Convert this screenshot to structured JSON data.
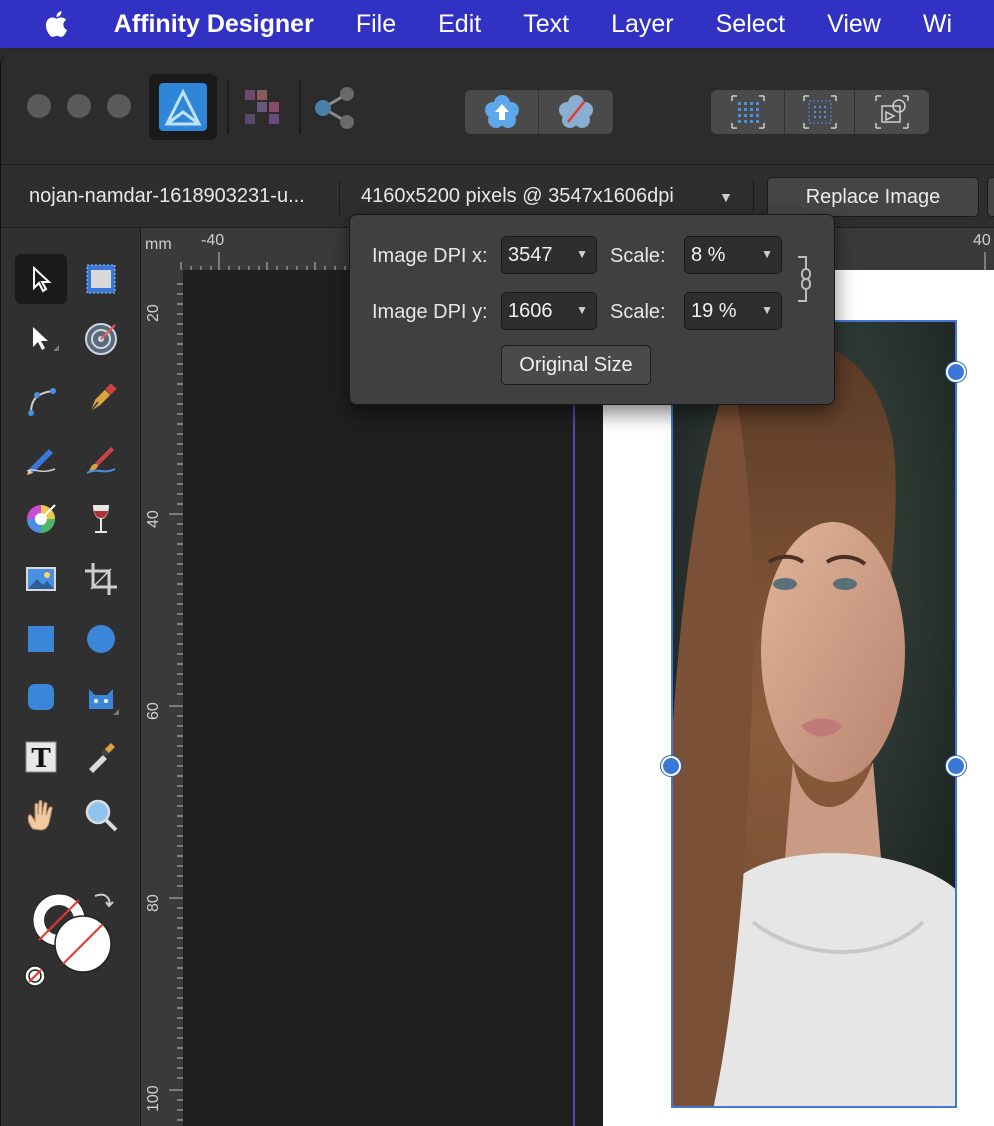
{
  "menubar": {
    "app_name": "Affinity Designer",
    "items": [
      "File",
      "Edit",
      "Text",
      "Layer",
      "Select",
      "View",
      "Wi"
    ]
  },
  "context": {
    "filename": "nojan-namdar-1618903231-u...",
    "dpi_info": "4160x5200 pixels @ 3547x1606dpi",
    "replace_label": "Replace Image"
  },
  "popover": {
    "dpi_x_label": "Image DPI x:",
    "dpi_x_value": "3547",
    "dpi_y_label": "Image DPI y:",
    "dpi_y_value": "1606",
    "scale_label": "Scale:",
    "scale_x_value": "8 %",
    "scale_y_value": "19 %",
    "original_size_label": "Original Size"
  },
  "ruler": {
    "unit": "mm",
    "top_labels": [
      "-40",
      "40"
    ],
    "left_labels": [
      "20",
      "40",
      "60",
      "80",
      "100"
    ]
  },
  "colors": {
    "menubar": "#3132c4",
    "accent": "#3b77d8",
    "panel": "#303030",
    "canvas": "#1f1f1f"
  }
}
